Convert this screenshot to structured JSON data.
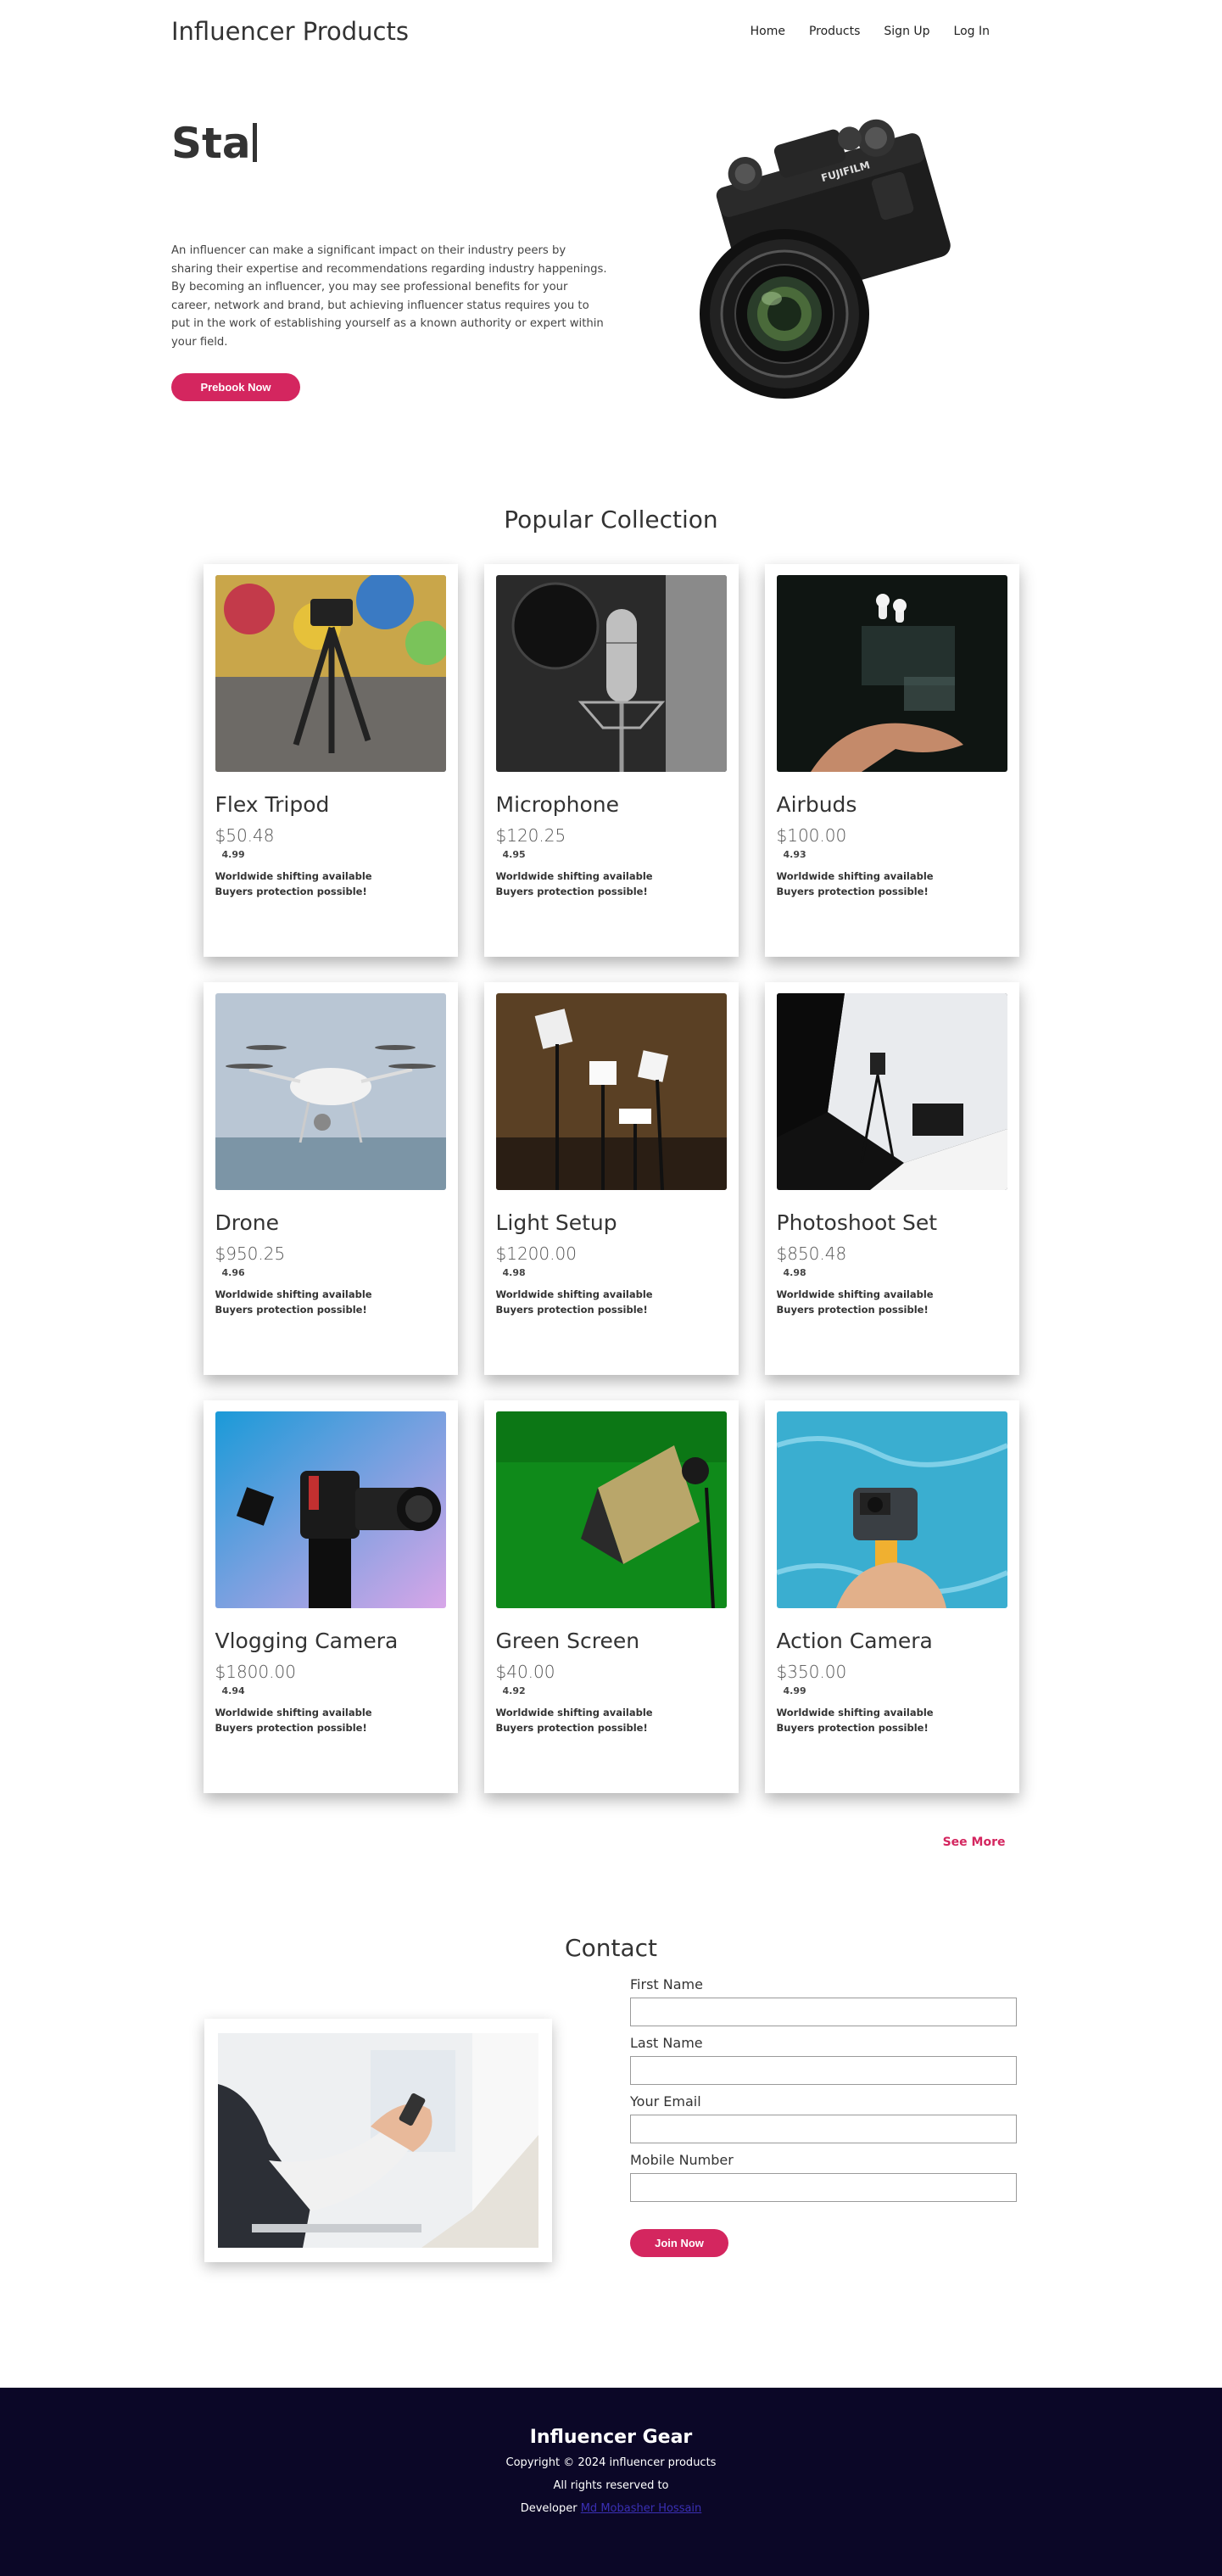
{
  "header": {
    "brand": "Influencer Products",
    "nav": [
      "Home",
      "Products",
      "Sign Up",
      "Log In"
    ]
  },
  "hero": {
    "title": "Sta",
    "text": "An influencer can make a significant impact on their industry peers by sharing their expertise and recommendations regarding industry happenings. By becoming an influencer, you may see professional benefits for your career, network and brand, but achieving influencer status requires you to put in the work of establishing yourself as a known authority or expert within your field.",
    "button": "Prebook Now"
  },
  "collection": {
    "title": "Popular Collection",
    "feature_1": "Worldwide shifting available",
    "feature_2": "Buyers protection possible!",
    "products": [
      {
        "name": "Flex Tripod",
        "price": "$50.48",
        "rating": "4.99"
      },
      {
        "name": "Microphone",
        "price": "$120.25",
        "rating": "4.95"
      },
      {
        "name": "Airbuds",
        "price": "$100.00",
        "rating": "4.93"
      },
      {
        "name": "Drone",
        "price": "$950.25",
        "rating": "4.96"
      },
      {
        "name": "Light Setup",
        "price": "$1200.00",
        "rating": "4.98"
      },
      {
        "name": "Photoshoot Set",
        "price": "$850.48",
        "rating": "4.98"
      },
      {
        "name": "Vlogging Camera",
        "price": "$1800.00",
        "rating": "4.94"
      },
      {
        "name": "Green Screen",
        "price": "$40.00",
        "rating": "4.92"
      },
      {
        "name": "Action Camera",
        "price": "$350.00",
        "rating": "4.99"
      }
    ],
    "see_more": "See More"
  },
  "contact": {
    "title": "Contact",
    "fields": [
      "First Name",
      "Last Name",
      "Your Email",
      "Mobile Number"
    ],
    "button": "Join Now"
  },
  "footer": {
    "title": "Influencer Gear",
    "copyright": "Copyright © 2024 influencer products",
    "rights": "All rights reserved to",
    "developer_label": "Developer",
    "developer_name": "Md Mobasher Hossain"
  },
  "colors": {
    "accent": "#d4265f",
    "footer_bg": "#0b0727",
    "link": "#3a2fb3"
  }
}
